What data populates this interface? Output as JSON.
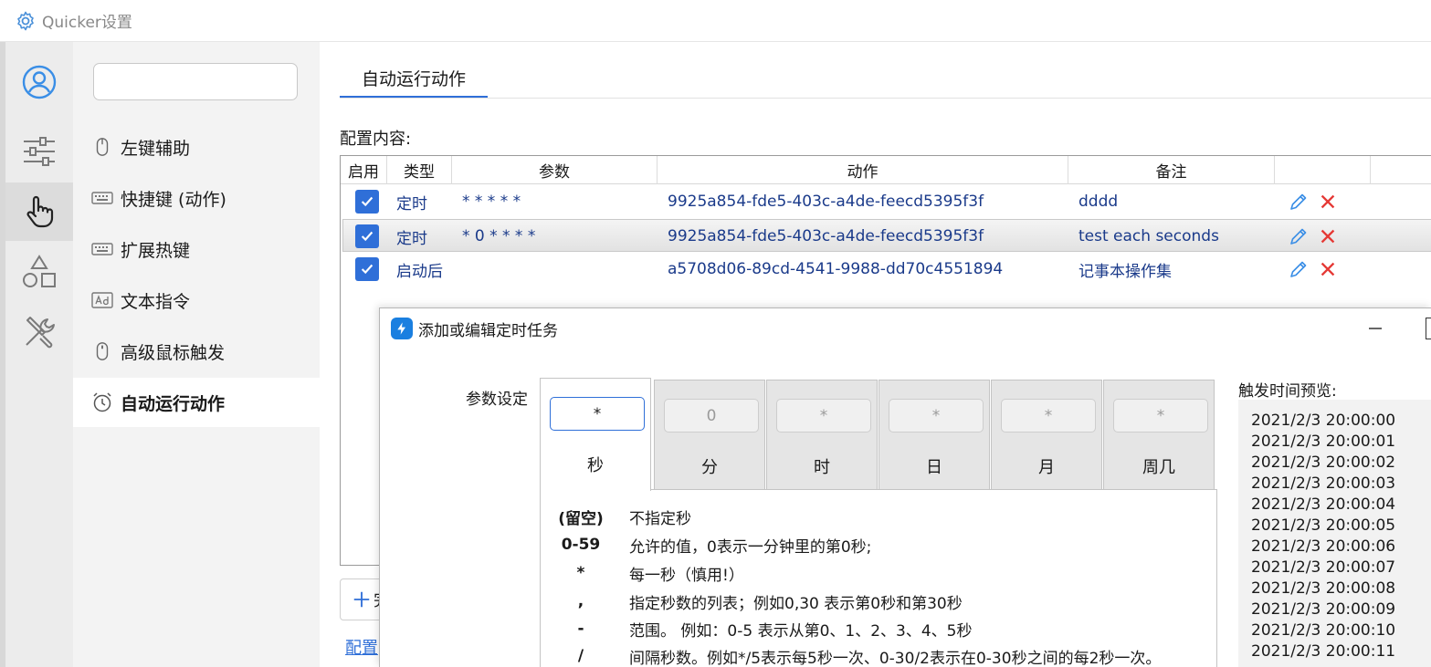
{
  "window": {
    "title": "Quicker设置"
  },
  "rail": {
    "items": [
      "user-icon",
      "sliders-icon",
      "hand-pointer-icon",
      "shapes-icon",
      "tools-icon"
    ],
    "active_index": 2
  },
  "sidenav": {
    "search": {
      "value": "",
      "placeholder": ""
    },
    "items": [
      {
        "icon": "mouse-icon",
        "label": "左键辅助"
      },
      {
        "icon": "keyboard-icon",
        "label": "快捷键 (动作)"
      },
      {
        "icon": "keyboard-icon",
        "label": "扩展热键"
      },
      {
        "icon": "ad-icon",
        "label": "文本指令"
      },
      {
        "icon": "mouse-icon",
        "label": "高级鼠标触发"
      },
      {
        "icon": "alarm-clock-icon",
        "label": "自动运行动作"
      }
    ],
    "active_index": 5
  },
  "main": {
    "tab": "自动运行动作",
    "config_label": "配置内容:",
    "table": {
      "columns": [
        "启用",
        "类型",
        "参数",
        "动作",
        "备注",
        "",
        ""
      ],
      "rows": [
        {
          "enabled": true,
          "type": "定时",
          "param": "* * * * *",
          "action": "9925a854-fde5-403c-a4de-feecd5395f3f",
          "note": "dddd"
        },
        {
          "enabled": true,
          "type": "定时",
          "param": "* 0 * * * *",
          "action": "9925a854-fde5-403c-a4de-feecd5395f3f",
          "note": "test each seconds"
        },
        {
          "enabled": true,
          "type": "启动后",
          "param": "",
          "action": "a5708d06-89cd-4541-9988-dd70c4551894",
          "note": "记事本操作集"
        }
      ],
      "selected_row": 1
    },
    "add_button": {
      "icon": "plus-icon",
      "label": "完"
    },
    "config_link": "配置"
  },
  "dialog": {
    "title": "添加或编辑定时任务",
    "param_label": "参数设定",
    "tabs": [
      {
        "value": "*",
        "label": "秒"
      },
      {
        "value": "0",
        "label": "分"
      },
      {
        "value": "*",
        "label": "时"
      },
      {
        "value": "*",
        "label": "日"
      },
      {
        "value": "*",
        "label": "月"
      },
      {
        "value": "*",
        "label": "周几"
      }
    ],
    "active_tab": 0,
    "help": [
      {
        "key": "(留空)",
        "desc": "不指定秒"
      },
      {
        "key": "0-59",
        "desc": "允许的值，0表示一分钟里的第0秒;"
      },
      {
        "key": "*",
        "desc": "每一秒（慎用!）"
      },
      {
        "key": ",",
        "desc": "指定秒数的列表；例如0,30 表示第0秒和第30秒"
      },
      {
        "key": "-",
        "desc": "范围。 例如：0-5 表示从第0、1、2、3、4、5秒"
      },
      {
        "key": "/",
        "desc": "间隔秒数。例如*/5表示每5秒一次、0-30/2表示在0-30秒之间的每2秒一次。"
      }
    ],
    "preview_label": "触发时间预览:",
    "preview": [
      "2021/2/3 20:00:00",
      "2021/2/3 20:00:01",
      "2021/2/3 20:00:02",
      "2021/2/3 20:00:03",
      "2021/2/3 20:00:04",
      "2021/2/3 20:00:05",
      "2021/2/3 20:00:06",
      "2021/2/3 20:00:07",
      "2021/2/3 20:00:08",
      "2021/2/3 20:00:09",
      "2021/2/3 20:00:10",
      "2021/2/3 20:00:11"
    ]
  },
  "colors": {
    "accent": "#2f6fd8",
    "delete": "#e53935",
    "link": "#1a3a8a"
  }
}
